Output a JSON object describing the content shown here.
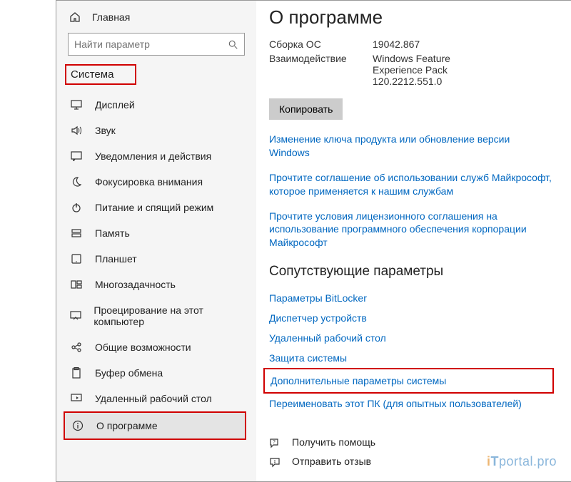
{
  "home_label": "Главная",
  "search_placeholder": "Найти параметр",
  "section_label": "Система",
  "nav": {
    "display": "Дисплей",
    "sound": "Звук",
    "notifications": "Уведомления и действия",
    "focus": "Фокусировка внимания",
    "power": "Питание и спящий режим",
    "storage": "Память",
    "tablet": "Планшет",
    "multitask": "Многозадачность",
    "projecting": "Проецирование на этот компьютер",
    "shared": "Общие возможности",
    "clipboard": "Буфер обмена",
    "remote": "Удаленный рабочий стол",
    "about": "О программе"
  },
  "page_title": "О программе",
  "os_build_label": "Сборка ОС",
  "os_build_value": "19042.867",
  "experience_label": "Взаимодействие",
  "experience_value_line1": "Windows Feature",
  "experience_value_line2": "Experience Pack",
  "experience_value_line3": "120.2212.551.0",
  "copy_button": "Копировать",
  "link_product_key": "Изменение ключа продукта или обновление версии Windows",
  "link_services_agreement": "Прочтите соглашение об использовании служб Майкрософт, которое применяется к нашим службам",
  "link_license_terms": "Прочтите условия лицензионного соглашения на использование программного обеспечения корпорации Майкрософт",
  "related_heading": "Сопутствующие параметры",
  "related": {
    "bitlocker": "Параметры BitLocker",
    "devices": "Диспетчер устройств",
    "remote": "Удаленный рабочий стол",
    "protect": "Защита системы",
    "advanced": "Дополнительные параметры системы",
    "rename": "Переименовать этот ПК (для опытных пользователей)"
  },
  "footer": {
    "help": "Получить помощь",
    "feedback": "Отправить отзыв"
  },
  "watermark": "portal.pro"
}
